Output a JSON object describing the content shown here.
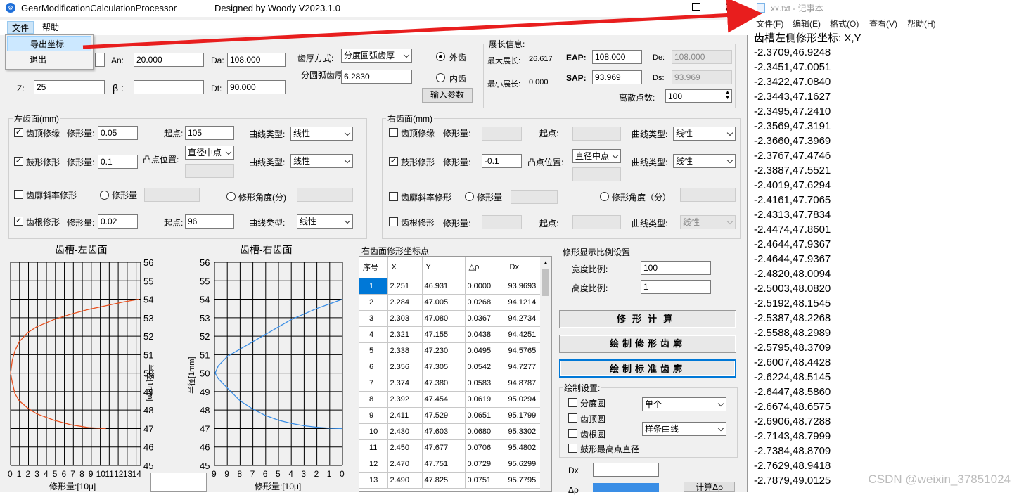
{
  "app": {
    "title": "GearModificationCalculationProcessor",
    "designer": "Designed by Woody  V2023.1.0",
    "menu": [
      "文件",
      "帮助"
    ],
    "file_menu_items": [
      "导出坐标",
      "退出"
    ]
  },
  "params": {
    "an_label": "An:",
    "an_value": "20.000",
    "da_label": "Da:",
    "da_value": "108.000",
    "z_label": "Z:",
    "z_value": "25",
    "beta_label": "β :",
    "beta_value": "",
    "df_label": "Df:",
    "df_value": "90.000",
    "tooth_thickness_label": "齿厚方式:",
    "tooth_thickness_value": "分度圆弧齿厚",
    "arc_thickness_label": "分圆弧齿厚",
    "arc_thickness_value": "6.2830",
    "external_label": "外齿",
    "internal_label": "内齿",
    "input_button": "输入参数"
  },
  "roll": {
    "title": "展长信息:",
    "max_label": "最大展长:",
    "max_value": "26.617",
    "min_label": "最小展长:",
    "min_value": "0.000",
    "eap_label": "EAP:",
    "eap_value": "108.000",
    "sap_label": "SAP:",
    "sap_value": "93.969",
    "de_label": "De:",
    "de_value": "108.000",
    "ds_label": "Ds:",
    "ds_value": "93.969",
    "points_label": "离散点数:",
    "points_value": "100"
  },
  "left_face": {
    "title": "左齿面(mm)",
    "tip_label": "齿顶修缘",
    "tip_amount_label": "修形量:",
    "tip_amount": "0.05",
    "tip_start_label": "起点:",
    "tip_start": "105",
    "curve_label": "曲线类型:",
    "tip_curve": "线性",
    "crown_label": "鼓形修形",
    "crown_amount": "0.1",
    "crown_pos_label": "凸点位置:",
    "crown_pos": "直径中点",
    "crown_curve": "线性",
    "slope_label": "齿廓斜率修形",
    "slope_amount_label": "修形量",
    "slope_angle_label": "修形角度(分)",
    "root_label": "齿根修形",
    "root_amount": "0.02",
    "root_start": "96",
    "root_curve": "线性"
  },
  "right_face": {
    "title": "右齿面(mm)",
    "tip_label": "齿顶修缘",
    "tip_amount_label": "修形量:",
    "tip_start_label": "起点:",
    "curve_label": "曲线类型:",
    "tip_curve": "线性",
    "crown_label": "鼓形修形",
    "crown_amount": "-0.1",
    "crown_pos_label": "凸点位置:",
    "crown_pos": "直径中点",
    "crown_curve": "线性",
    "slope_label": "齿廓斜率修形",
    "slope_amount_label": "修形量",
    "slope_angle_label": "修形角度（分）",
    "root_label": "齿根修形",
    "root_amount_label": "修形量:",
    "root_start_label": "起点:",
    "root_curve": "线性"
  },
  "charts": {
    "left_title": "齿槽-左齿面",
    "right_title": "齿槽-右齿面",
    "left_xlabel": "修形量:[10μ]",
    "right_xlabel": "修形量:[10μ]",
    "left_ylabel": "半径[1mm]",
    "right_ylabel": "半径[1mm]"
  },
  "chart_data": [
    {
      "type": "line",
      "title": "齿槽-左齿面",
      "xlabel": "修形量:[10μ]",
      "ylabel": "半径[1mm]",
      "x_ticks": [
        "0",
        "1",
        "2",
        "3",
        "4",
        "5",
        "6",
        "7",
        "8",
        "9",
        "10",
        "11",
        "12",
        "13",
        "14"
      ],
      "y_ticks": [
        "45",
        "46",
        "47",
        "48",
        "49",
        "50",
        "51",
        "52",
        "53",
        "54",
        "55",
        "56"
      ],
      "xlim": [
        0,
        15
      ],
      "ylim": [
        45,
        56
      ],
      "color": "#e8501e",
      "series": [
        {
          "x": [
            11,
            9,
            7,
            5,
            3,
            2,
            1,
            0.5,
            0.2,
            0,
            0.2,
            0.5,
            1,
            2,
            3,
            5,
            7,
            9,
            11,
            13,
            14.8
          ],
          "y": [
            47,
            47.05,
            47.2,
            47.45,
            47.8,
            48.1,
            48.5,
            48.9,
            49.5,
            50,
            50.7,
            51.2,
            51.7,
            52.2,
            52.5,
            52.9,
            53.2,
            53.45,
            53.65,
            53.85,
            54
          ]
        }
      ]
    },
    {
      "type": "line",
      "title": "齿槽-右齿面",
      "xlabel": "修形量:[10μ]",
      "ylabel": "半径[1mm]",
      "x_ticks": [
        "9",
        "9",
        "8",
        "7",
        "6",
        "5",
        "4",
        "3",
        "2",
        "1",
        "0"
      ],
      "y_ticks": [
        "45",
        "46",
        "47",
        "48",
        "49",
        "50",
        "51",
        "52",
        "53",
        "54",
        "55",
        "56"
      ],
      "ylim": [
        45,
        56
      ],
      "color": "#3a8ee6",
      "series": [
        {
          "x": [
            0,
            1,
            2,
            3,
            4,
            5,
            6,
            7,
            8,
            9,
            9.7,
            9.95,
            9.7,
            9,
            8,
            7,
            6,
            5,
            4,
            3,
            2,
            1,
            0
          ],
          "y": [
            47,
            47.02,
            47.07,
            47.15,
            47.28,
            47.45,
            47.7,
            48.05,
            48.5,
            49.2,
            49.7,
            50,
            50.4,
            50.9,
            51.3,
            51.7,
            52.1,
            52.5,
            52.9,
            53.2,
            53.5,
            53.75,
            54
          ]
        }
      ]
    }
  ],
  "table": {
    "title": "右齿面修形坐标点",
    "headers": [
      "序号",
      "X",
      "Y",
      "△ρ",
      "Dx"
    ],
    "rows": [
      [
        "1",
        "2.251",
        "46.931",
        "0.0000",
        "93.9693"
      ],
      [
        "2",
        "2.284",
        "47.005",
        "0.0268",
        "94.1214"
      ],
      [
        "3",
        "2.303",
        "47.080",
        "0.0367",
        "94.2734"
      ],
      [
        "4",
        "2.321",
        "47.155",
        "0.0438",
        "94.4251"
      ],
      [
        "5",
        "2.338",
        "47.230",
        "0.0495",
        "94.5765"
      ],
      [
        "6",
        "2.356",
        "47.305",
        "0.0542",
        "94.7277"
      ],
      [
        "7",
        "2.374",
        "47.380",
        "0.0583",
        "94.8787"
      ],
      [
        "8",
        "2.392",
        "47.454",
        "0.0619",
        "95.0294"
      ],
      [
        "9",
        "2.411",
        "47.529",
        "0.0651",
        "95.1799"
      ],
      [
        "10",
        "2.430",
        "47.603",
        "0.0680",
        "95.3302"
      ],
      [
        "11",
        "2.450",
        "47.677",
        "0.0706",
        "95.4802"
      ],
      [
        "12",
        "2.470",
        "47.751",
        "0.0729",
        "95.6299"
      ],
      [
        "13",
        "2.490",
        "47.825",
        "0.0751",
        "95.7795"
      ]
    ]
  },
  "scale": {
    "title": "修形显示比例设置",
    "width_label": "宽度比例:",
    "width_value": "100",
    "height_label": "高度比例:",
    "height_value": "1"
  },
  "actions": {
    "calc": "修形计算",
    "draw_mod": "绘制修形齿廓",
    "draw_std": "绘制标准齿廓"
  },
  "draw": {
    "title": "绘制设置:",
    "pitch": "分度圆",
    "tip": "齿顶圆",
    "root": "齿根圆",
    "crown_top": "鼓形最高点直径",
    "mode": "单个",
    "curve": "样条曲线",
    "dx_label": "Dx",
    "drho_label": "Δρ",
    "calc_drho": "计算Δρ"
  },
  "notepad": {
    "title": "xx.txt - 记事本",
    "menu": [
      "文件(F)",
      "编辑(E)",
      "格式(O)",
      "查看(V)",
      "帮助(H)"
    ],
    "lines": [
      "齿槽左侧修形坐标: X,Y",
      "-2.3709,46.9248",
      "-2.3451,47.0051",
      "-2.3422,47.0840",
      "-2.3443,47.1627",
      "-2.3495,47.2410",
      "-2.3569,47.3191",
      "-2.3660,47.3969",
      "-2.3767,47.4746",
      "-2.3887,47.5521",
      "-2.4019,47.6294",
      "-2.4161,47.7065",
      "-2.4313,47.7834",
      "-2.4474,47.8601",
      "-2.4644,47.9367",
      "-2.4644,47.9367",
      "-2.4820,48.0094",
      "-2.5003,48.0820",
      "-2.5192,48.1545",
      "-2.5387,48.2268",
      "-2.5588,48.2989",
      "-2.5795,48.3709",
      "-2.6007,48.4428",
      "-2.6224,48.5145",
      "-2.6447,48.5860",
      "-2.6674,48.6575",
      "-2.6906,48.7288",
      "-2.7143,48.7999",
      "-2.7384,48.8709",
      "-2.7629,48.9418",
      "-2.7879,49.0125"
    ]
  },
  "watermark": "CSDN @weixin_37851024",
  "colors": {
    "accent": "#0078d7",
    "arrow": "#e81e1e",
    "left_curve": "#e8501e",
    "right_curve": "#3a8ee6"
  }
}
